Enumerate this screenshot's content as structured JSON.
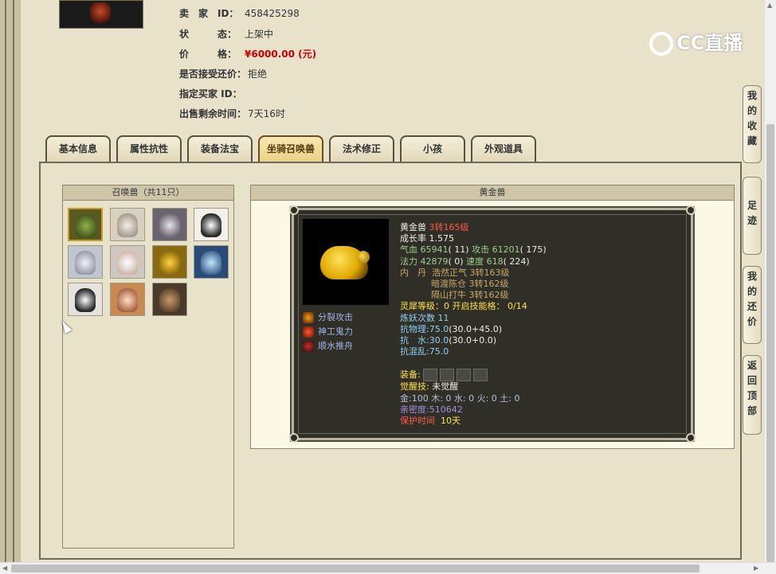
{
  "seller": {
    "rows": [
      {
        "label": "卖　家　ID：",
        "value": "458425298"
      },
      {
        "label": "状　　　态：",
        "value": "上架中"
      },
      {
        "label": "价　　　格：",
        "value": "¥6000.00 (元)"
      },
      {
        "label": "是否接受还价：",
        "value": "拒绝"
      },
      {
        "label": "指定买家 ID：",
        "value": ""
      },
      {
        "label": "出售剩余时间：",
        "value": "7天16时"
      }
    ]
  },
  "tabs": [
    "基本信息",
    "属性抗性",
    "装备法宝",
    "坐骑召唤兽",
    "法术修正",
    "小孩",
    "外观道具"
  ],
  "active_tab": "坐骑召唤兽",
  "pet_list": {
    "header": "召唤兽（共11只）",
    "count": 11
  },
  "detail": {
    "header": "黄金兽",
    "name": "黄金兽",
    "level": "3转165级",
    "growth_label": "成长率",
    "growth": "1.575",
    "hp_label": "气血",
    "hp": "65941",
    "hp_extra": "( 11)",
    "atk_label": "攻击",
    "atk": "61201",
    "atk_extra": "( 175)",
    "mp_label": "法力",
    "mp": "42879",
    "mp_extra": "( 0)",
    "spd_label": "速度",
    "spd": "618",
    "spd_extra": "( 224)",
    "neidan_label": "内　丹",
    "neidan": [
      {
        "name": "浩然正气",
        "level": "3转163级"
      },
      {
        "name": "暗渡陈仓",
        "level": "3转162级"
      },
      {
        "name": "隔山打牛",
        "level": "3转162级"
      }
    ],
    "lingxi_label": "灵犀等级：",
    "lingxi": "0 开启技能格：",
    "lingxi_slots": "0/14",
    "lianyao_label": "炼妖次数",
    "lianyao": "11",
    "phys_res_label": "抗物理:",
    "phys_res": "75.0",
    "phys_res_extra": "(30.0+45.0)",
    "water_res_label": "抗　水:",
    "water_res": "30.0",
    "water_res_extra": "(30.0+0.0)",
    "chaos_res_label": "抗混乱:",
    "chaos_res": "75.0",
    "equip_label": "装备:",
    "awaken_label": "觉醒技:",
    "awaken": "未觉醒",
    "elements": "金:100 木: 0 水: 0 火: 0 土: 0",
    "intimacy": "亲密度:510642",
    "protect_label": "保护时间",
    "protect": "10天",
    "skills": [
      "分裂攻击",
      "神工鬼力",
      "顺水推舟"
    ]
  },
  "side_buttons": [
    "我的收藏",
    "足迹",
    "我的还价",
    "返回顶部"
  ],
  "watermark": "CC直播",
  "colors": {
    "price": "#c40000",
    "background": "#e9e2cb",
    "card": "#2f2f27"
  }
}
